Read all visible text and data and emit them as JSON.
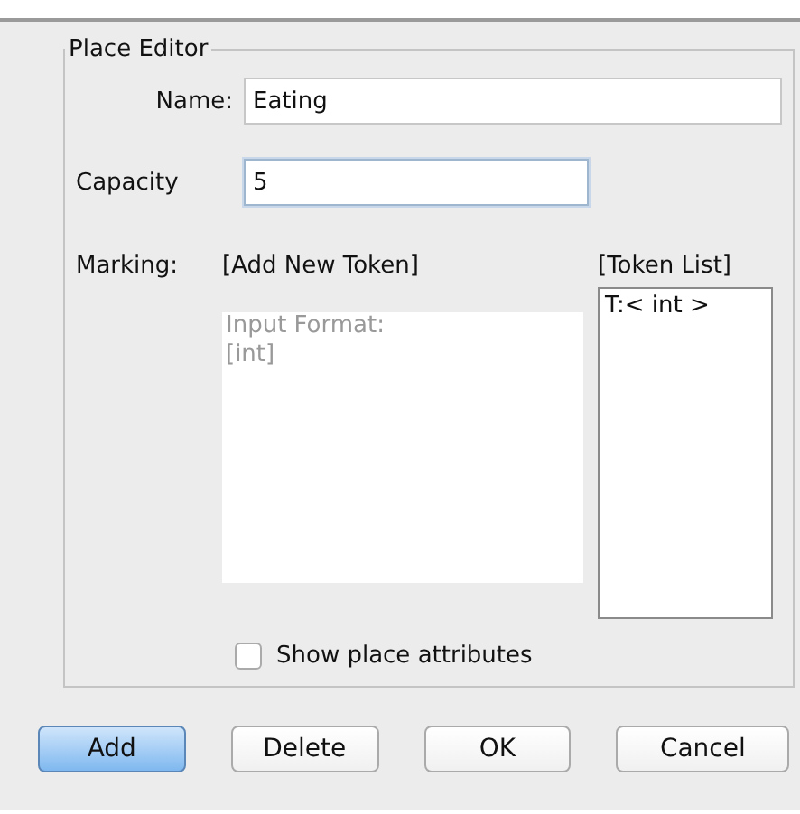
{
  "panel": {
    "title": "Place Editor"
  },
  "name": {
    "label": "Name:",
    "value": "Eating"
  },
  "capacity": {
    "label": "Capacity",
    "value": "5",
    "focused": true
  },
  "marking": {
    "label": "Marking:",
    "add_label": "[Add New Token]",
    "placeholder": "Input Format:\n[int]"
  },
  "token_list": {
    "label": "[Token List]",
    "items": [
      "T:< int >"
    ]
  },
  "show_attributes": {
    "label": "Show place attributes",
    "checked": false
  },
  "buttons": [
    {
      "label": "Add",
      "default": true
    },
    {
      "label": "Delete",
      "default": false
    },
    {
      "label": "OK",
      "default": false
    },
    {
      "label": "Cancel",
      "default": false
    }
  ]
}
